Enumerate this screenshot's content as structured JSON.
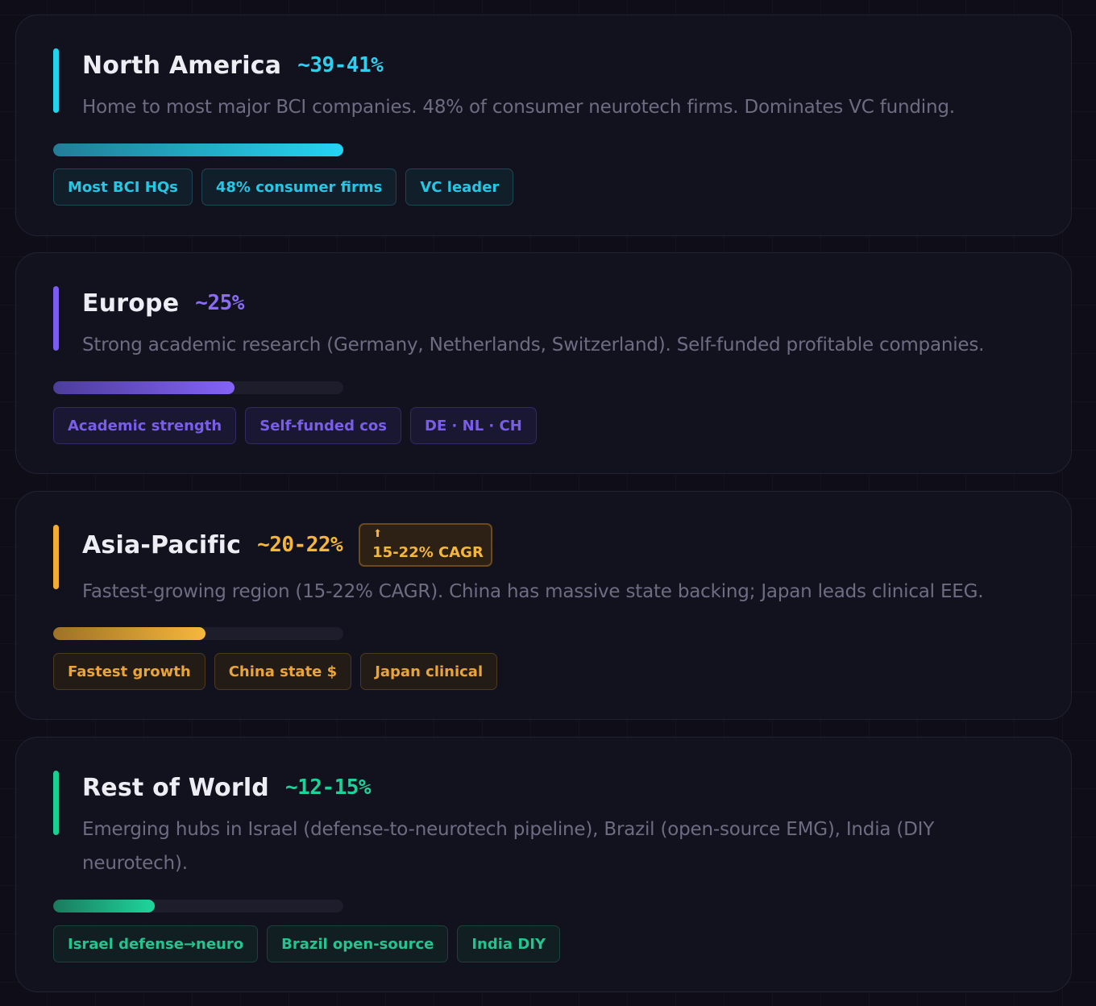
{
  "regions": [
    {
      "id": "na",
      "name": "North America",
      "share": "~39-41%",
      "description": "Home to most major BCI companies. 48% of consumer neurotech firms. Dominates VC funding.",
      "progress_fraction": 1.0,
      "tags": [
        "Most BCI HQs",
        "48% consumer firms",
        "VC leader"
      ],
      "accent_color": "#22d3ee"
    },
    {
      "id": "eu",
      "name": "Europe",
      "share": "~25%",
      "description": "Strong academic research (Germany, Netherlands, Switzerland). Self-funded profitable companies.",
      "progress_fraction": 0.625,
      "tags": [
        "Academic strength",
        "Self-funded cos",
        "DE · NL · CH"
      ],
      "accent_color": "#7c5cf0"
    },
    {
      "id": "ap",
      "name": "Asia-Pacific",
      "share": "~20-22%",
      "badge": {
        "icon": "up-arrow-icon",
        "arrow": "⬆",
        "text": "15-22% CAGR"
      },
      "description": "Fastest-growing region (15-22% CAGR). China has massive state backing; Japan leads clinical EEG.",
      "progress_fraction": 0.525,
      "tags": [
        "Fastest growth",
        "China state $",
        "Japan clinical"
      ],
      "accent_color": "#f3ac32"
    },
    {
      "id": "rw",
      "name": "Rest of World",
      "share": "~12-15%",
      "description": "Emerging hubs in Israel (defense-to-neurotech pipeline), Brazil (open-source EMG), India (DIY neurotech).",
      "progress_fraction": 0.35,
      "tags": [
        "Israel defense→neuro",
        "Brazil open-source",
        "India DIY"
      ],
      "accent_color": "#19cf91"
    }
  ]
}
